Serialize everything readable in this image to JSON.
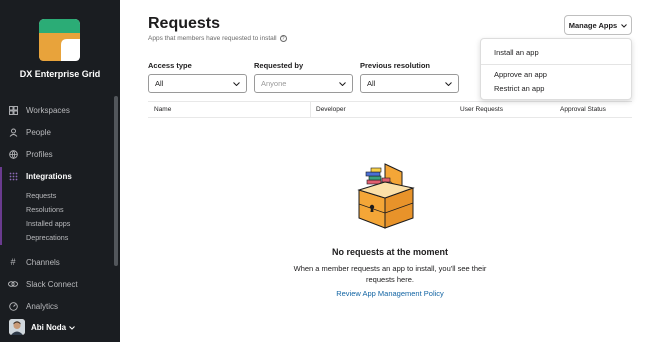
{
  "sidebar": {
    "org_name": "DX Enterprise Grid",
    "logo": {
      "colors": [
        "#2bac76",
        "#e8a33b",
        "#ffffff"
      ]
    },
    "items": [
      {
        "label": "Workspaces",
        "icon": "building-icon"
      },
      {
        "label": "People",
        "icon": "person-icon"
      },
      {
        "label": "Profiles",
        "icon": "globe-icon"
      },
      {
        "label": "Integrations",
        "icon": "grid-icon",
        "active": true
      },
      {
        "label": "Channels",
        "icon": "hash-icon"
      },
      {
        "label": "Slack Connect",
        "icon": "link-icon"
      },
      {
        "label": "Analytics",
        "icon": "gauge-icon"
      }
    ],
    "subitems": [
      "Requests",
      "Resolutions",
      "Installed apps",
      "Deprecations"
    ],
    "user": {
      "name": "Abi Noda"
    }
  },
  "main": {
    "title": "Requests",
    "subtitle": "Apps that members have requested to install",
    "manage_button": "Manage Apps",
    "filters": [
      {
        "label": "Access type",
        "value": "All",
        "placeholder": false
      },
      {
        "label": "Requested by",
        "value": "Anyone",
        "placeholder": true
      },
      {
        "label": "Previous resolution",
        "value": "All",
        "placeholder": false
      }
    ],
    "columns": [
      "Name",
      "Developer",
      "User Requests",
      "Approval Status"
    ],
    "empty": {
      "title": "No requests at the moment",
      "body": "When a member requests an app to install, you'll see their requests here.",
      "link": "Review App Management Policy"
    }
  },
  "menu": {
    "items": [
      "Install an app",
      "Approve an app",
      "Restrict an app"
    ]
  },
  "colors": {
    "sidebar_bg": "#1a1d21",
    "accent": "#6a3b8f",
    "link": "#1264a3",
    "illustration": "#f4a637"
  }
}
